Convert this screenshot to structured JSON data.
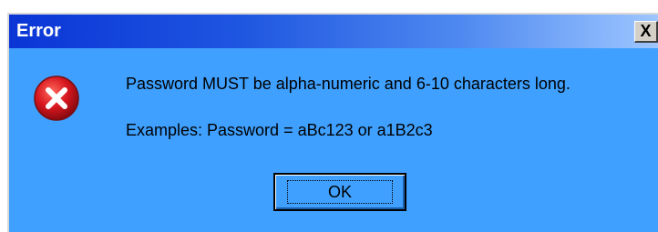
{
  "dialog": {
    "title": "Error",
    "close_label": "X",
    "message": "Password MUST be alpha-numeric and 6-10 characters long.",
    "example": "Examples: Password = aBc123 or a1B2c3",
    "ok_label": "OK",
    "icon": "error-icon"
  },
  "colors": {
    "body_background": "#3fa0ff",
    "titlebar_start": "#0a35d6",
    "titlebar_end": "#9ec6ff",
    "error_red": "#d8171f"
  }
}
